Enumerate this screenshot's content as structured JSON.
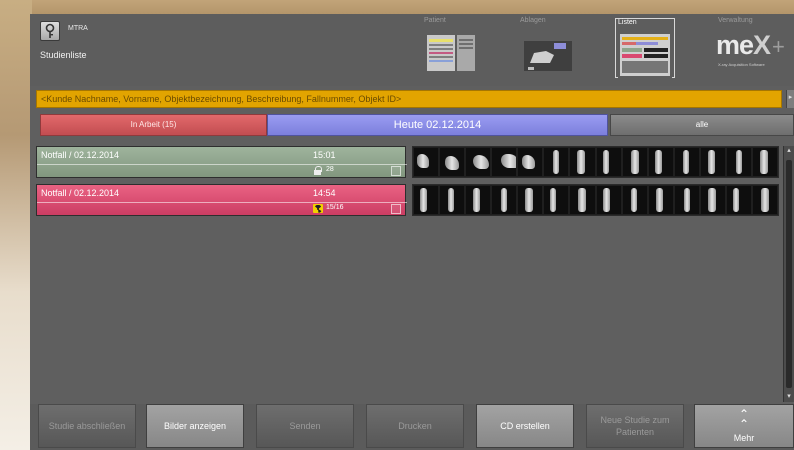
{
  "header": {
    "role": "MTRA",
    "page_title": "Studienliste",
    "nav": [
      {
        "label": "Patient",
        "active": false
      },
      {
        "label": "Ablagen",
        "active": false
      },
      {
        "label": "Listen",
        "active": true
      },
      {
        "label": "Verwaltung",
        "active": false
      }
    ],
    "logo": {
      "main": "me",
      "x": "X",
      "plus": "+",
      "sub": "X-ray Acquisition Software"
    }
  },
  "search": {
    "placeholder": "<Kunde Nachname, Vorname, Objektbezeichnung, Beschreibung, Fallnummer, Objekt ID>"
  },
  "filters": {
    "in_work": "In Arbeit (15)",
    "date": "Heute 02.12.2014",
    "all": "alle"
  },
  "studies": [
    {
      "title": "Notfall / 02.12.2014",
      "time": "15:01",
      "count": "28",
      "status_icon": "lock-icon",
      "color": "#8ea48b",
      "thumb_count": 14
    },
    {
      "title": "Notfall / 02.12.2014",
      "time": "14:54",
      "count": "15/16",
      "status_icon": "radiation-icon",
      "color": "#d94a70",
      "thumb_count": 14
    }
  ],
  "toolbar": {
    "close_study": "Studie abschließen",
    "show_images": "Bilder anzeigen",
    "send": "Senden",
    "print": "Drucken",
    "create_cd": "CD erstellen",
    "new_study": "Neue Studie zum Patienten",
    "more": "Mehr"
  },
  "colors": {
    "search_bar": "#e2a400",
    "in_work": "#d65b5e",
    "date_filter": "#8c8fe8",
    "study_green": "#8ea48b",
    "study_pink": "#d94a70"
  }
}
